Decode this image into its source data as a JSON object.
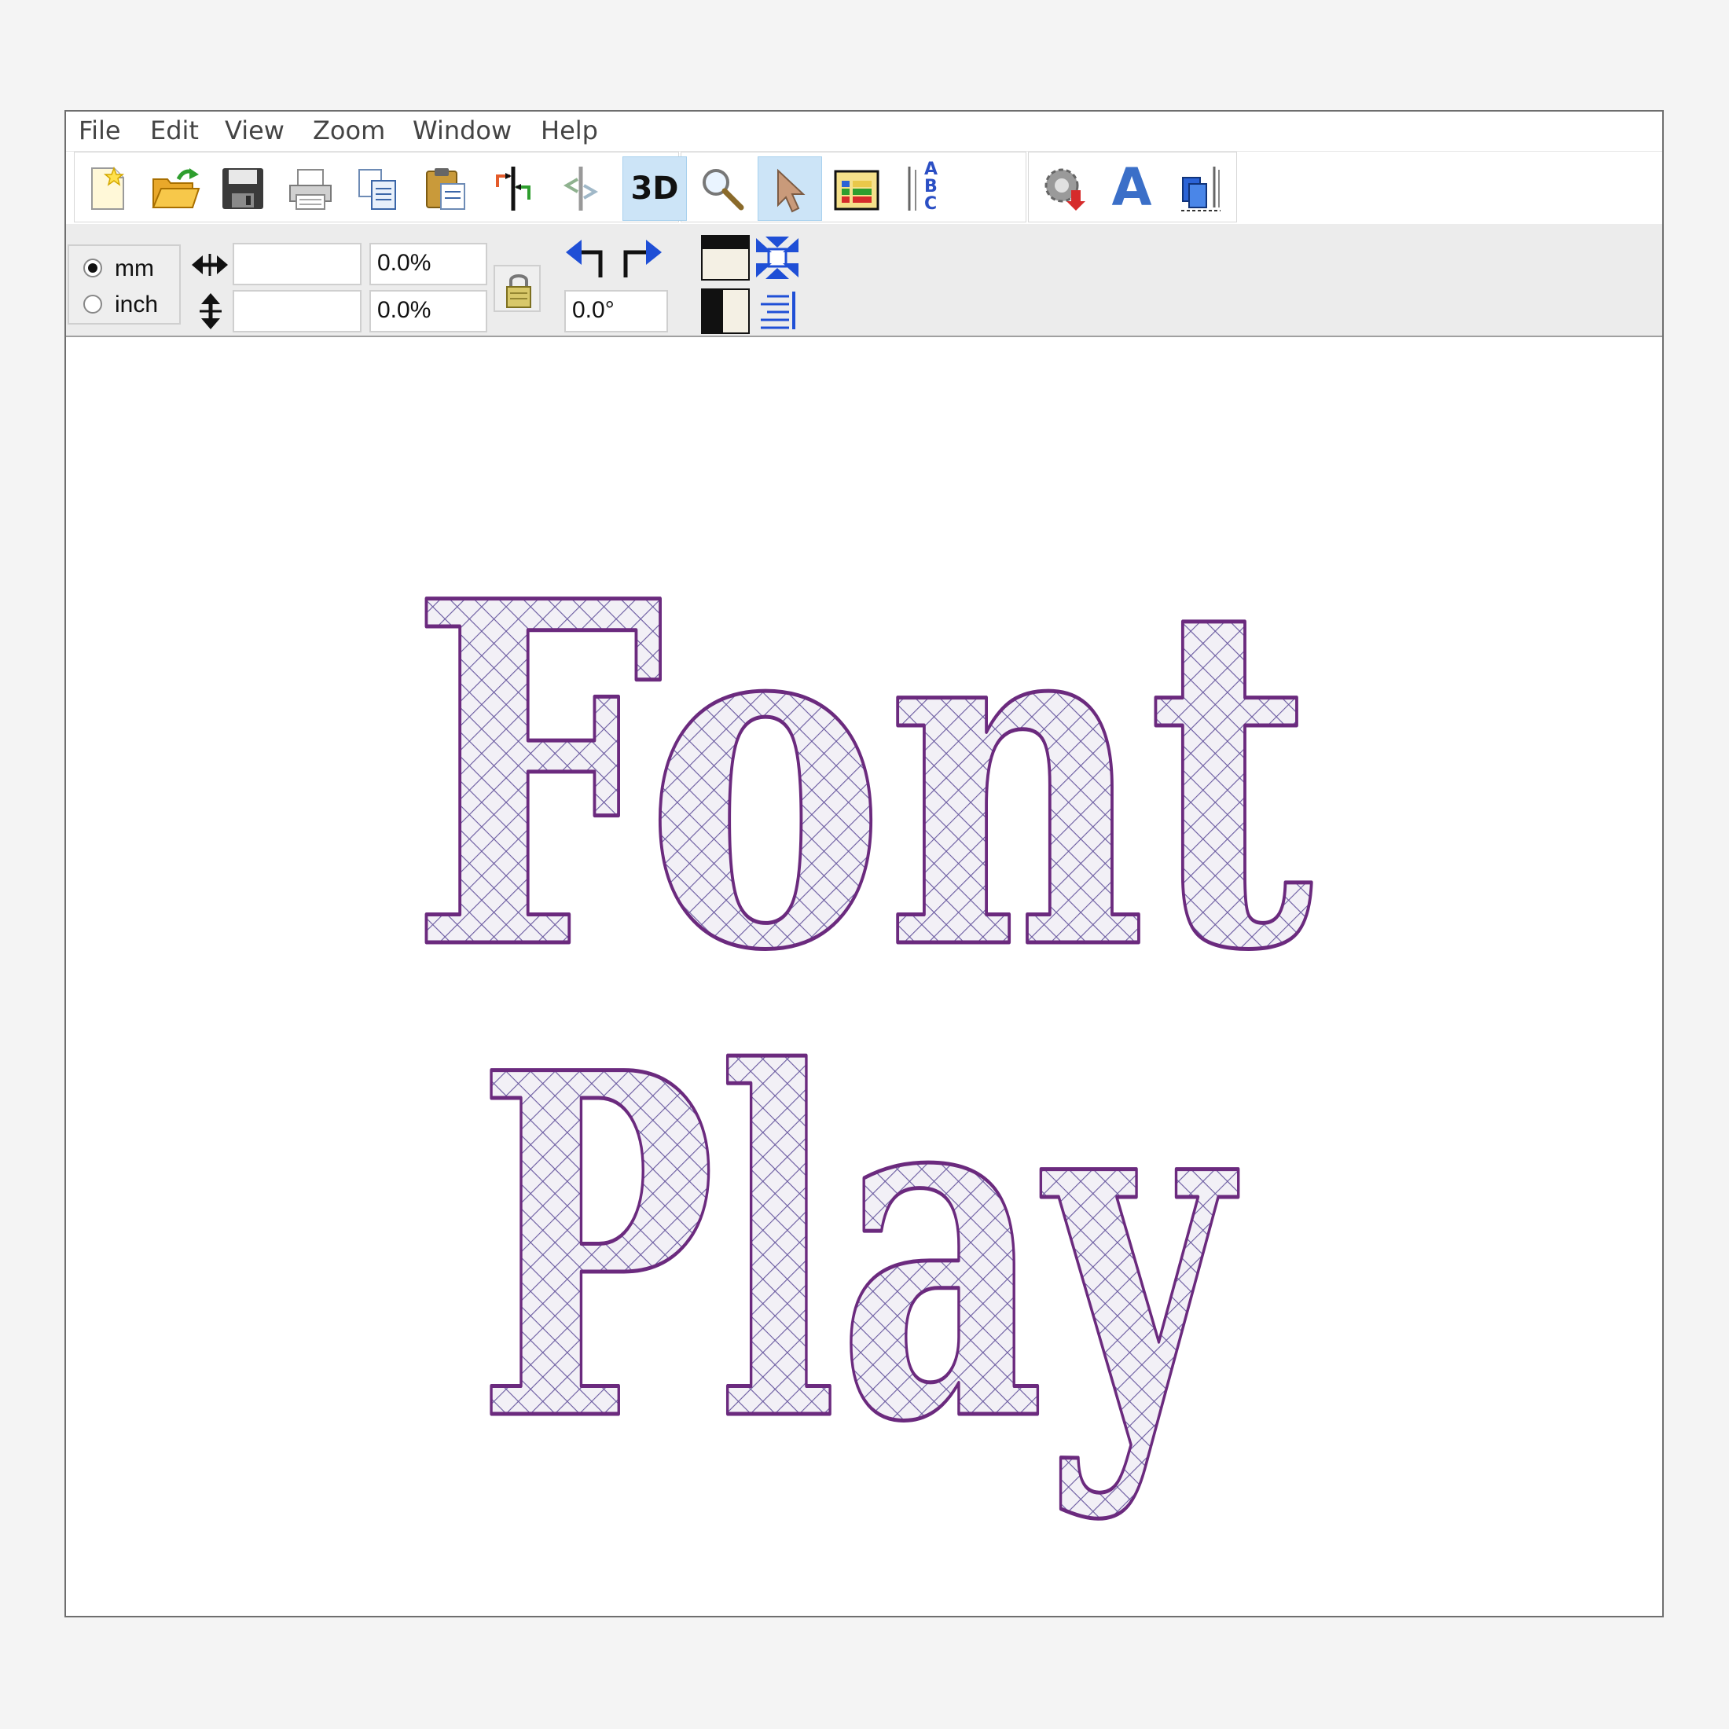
{
  "menu": {
    "items": [
      "File",
      "Edit",
      "View",
      "Zoom",
      "Window",
      "Help"
    ]
  },
  "toolbar": {
    "buttons": [
      "new",
      "open",
      "save",
      "print",
      "copy",
      "paste",
      "flip-horizontal",
      "flip-vertical",
      "3d-view",
      "zoom",
      "select",
      "color-palette",
      "lettering",
      "settings",
      "text",
      "embroidery-machine"
    ],
    "three_d_label": "3D",
    "lettering_glyphs": "ABC",
    "text_tool_glyph": "A"
  },
  "properties": {
    "units": {
      "mm": "mm",
      "inch": "inch",
      "selected": "mm"
    },
    "width_value": "",
    "height_value": "",
    "width_percent": "0.0%",
    "height_percent": "0.0%",
    "rotation": "0.0°"
  },
  "canvas": {
    "design_text_line1": "Font",
    "design_text_line2": "Play",
    "outline_color": "#6b2a7e",
    "fill_color": "#f2f0f6",
    "stitch_color": "#6a5aa0"
  }
}
